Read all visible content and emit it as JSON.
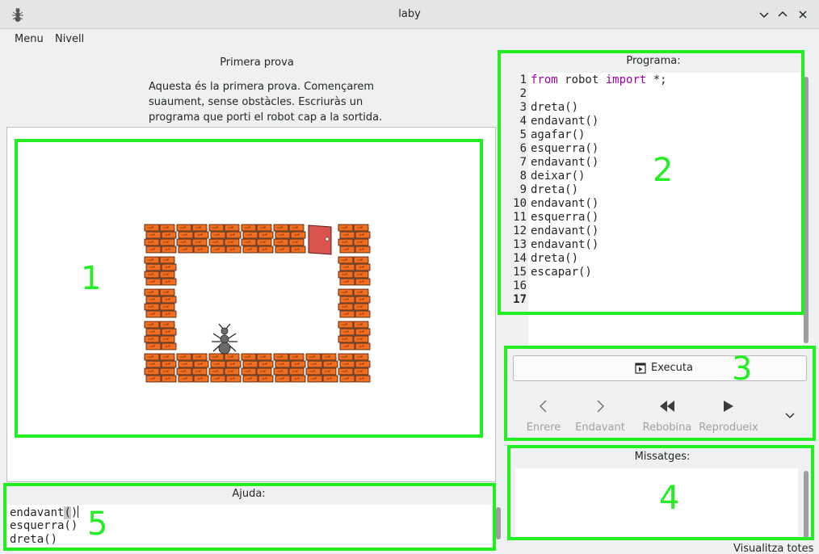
{
  "window": {
    "title": "laby"
  },
  "icons": {
    "app": "ant-icon",
    "minimize": "chevron-down-icon",
    "maximize": "chevron-up-icon",
    "close": "close-icon"
  },
  "menu": {
    "items": [
      "Menu",
      "Nivell"
    ]
  },
  "level": {
    "title": "Primera prova",
    "description_lines": [
      "Aquesta és la primera prova. Començarem",
      "suaument, sense obstàcles. Escriuràs un",
      "programa que porti el robot cap a la sortida."
    ]
  },
  "board": {
    "cols": 7,
    "rows": 5,
    "grid": [
      "WWWWWDW",
      "W.....W",
      "W.....W",
      "W.....W",
      "WWWWWWW"
    ],
    "ant": {
      "col": 2,
      "row": 3,
      "facing": "north"
    },
    "colors": {
      "wall": "#f26f21",
      "wall_line": "#3a1a08",
      "door": "#d9534f"
    }
  },
  "program": {
    "label": "Programa:",
    "lines": [
      {
        "n": "1",
        "parts": [
          [
            "kw",
            "from"
          ],
          [
            "t",
            " robot "
          ],
          [
            "kw",
            "import"
          ],
          [
            "t",
            " *;"
          ]
        ]
      },
      {
        "n": "2",
        "parts": []
      },
      {
        "n": "3",
        "parts": [
          [
            "t",
            "dreta()"
          ]
        ]
      },
      {
        "n": "4",
        "parts": [
          [
            "t",
            "endavant()"
          ]
        ]
      },
      {
        "n": "5",
        "parts": [
          [
            "t",
            "agafar()"
          ]
        ]
      },
      {
        "n": "6",
        "parts": [
          [
            "t",
            "esquerra()"
          ]
        ]
      },
      {
        "n": "7",
        "parts": [
          [
            "t",
            "endavant()"
          ]
        ]
      },
      {
        "n": "8",
        "parts": [
          [
            "t",
            "deixar()"
          ]
        ]
      },
      {
        "n": "9",
        "parts": [
          [
            "t",
            "dreta()"
          ]
        ]
      },
      {
        "n": "10",
        "parts": [
          [
            "t",
            "endavant()"
          ]
        ]
      },
      {
        "n": "11",
        "parts": [
          [
            "t",
            "esquerra()"
          ]
        ]
      },
      {
        "n": "12",
        "parts": [
          [
            "t",
            "endavant()"
          ]
        ]
      },
      {
        "n": "13",
        "parts": [
          [
            "t",
            "endavant()"
          ]
        ]
      },
      {
        "n": "14",
        "parts": [
          [
            "t",
            "dreta()"
          ]
        ]
      },
      {
        "n": "15",
        "parts": [
          [
            "t",
            "escapar()"
          ]
        ]
      },
      {
        "n": "16",
        "parts": []
      },
      {
        "n": "17",
        "parts": [],
        "current": true
      }
    ],
    "keyword_color": "#a000a0"
  },
  "controls": {
    "run_label": "Executa",
    "run_icon": "play-window-icon",
    "back_label": "Enrere",
    "forward_label": "Endavant",
    "rewind_label": "Rebobina",
    "play_label": "Reprodueix",
    "more_icon": "chevron-down-icon"
  },
  "messages": {
    "label": "Missatges:"
  },
  "help": {
    "label": "Ajuda:",
    "lines": [
      "endavant()",
      "esquerra()",
      "dreta()"
    ]
  },
  "annotations": {
    "color": "#22ee22",
    "numbers": [
      "1",
      "2",
      "3",
      "4",
      "5"
    ]
  },
  "footer": {
    "partial_text": "Visualitza totes"
  }
}
